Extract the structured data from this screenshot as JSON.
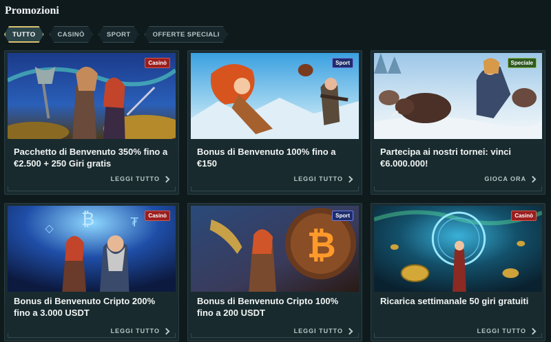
{
  "page": {
    "title": "Promozioni"
  },
  "tabs": [
    {
      "label": "TUTTO",
      "active": true
    },
    {
      "label": "CASINÒ",
      "active": false
    },
    {
      "label": "SPORT",
      "active": false
    },
    {
      "label": "OFFERTE SPECIALI",
      "active": false
    }
  ],
  "cards": [
    {
      "badge": "Casinò",
      "title": "Pacchetto di Benvenuto 350% fino a €2.500 + 250 Giri gratis",
      "link": "LEGGI TUTTO"
    },
    {
      "badge": "Sport",
      "title": "Bonus di Benvenuto 100% fino a €150",
      "link": "LEGGI TUTTO"
    },
    {
      "badge": "Speciale",
      "title": "Partecipa ai nostri tornei: vinci €6.000.000!",
      "link": "GIOCA ORA"
    },
    {
      "badge": "Casinò",
      "title": "Bonus di Benvenuto Cripto 200% fino a 3.000 USDT",
      "link": "LEGGI TUTTO"
    },
    {
      "badge": "Sport",
      "title": "Bonus di Benvenuto Cripto 100% fino a 200 USDT",
      "link": "LEGGI TUTTO"
    },
    {
      "badge": "Casinò",
      "title": "Ricarica settimanale 50 giri gratuiti",
      "link": "LEGGI TUTTO"
    }
  ],
  "colors": {
    "background": "#0f1a1d",
    "card": "#1b2c31",
    "accent_gold": "#e2c979",
    "badge_casino": "#9b1e1e",
    "badge_sport": "#1e2c6c",
    "badge_speciale": "#2f5a23"
  },
  "icons": [
    "chevron-right-icon"
  ]
}
